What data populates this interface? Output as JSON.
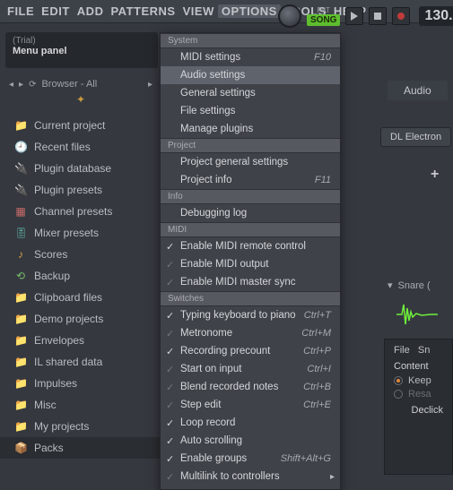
{
  "menubar": {
    "items": [
      "FILE",
      "EDIT",
      "ADD",
      "PATTERNS",
      "VIEW",
      "OPTIONS",
      "TOOLS",
      "HELP"
    ],
    "active_index": 5
  },
  "topbar": {
    "pat_label": "PAT",
    "song_label": "SONG",
    "tempo": "130."
  },
  "hint": {
    "trial": "(Trial)",
    "title": "Menu panel"
  },
  "browser": {
    "label": "Browser - All",
    "star": "✦"
  },
  "sidebar": {
    "items": [
      {
        "icon": "📁",
        "cls": "c-folder",
        "label": "Current project"
      },
      {
        "icon": "🕘",
        "cls": "c-blue",
        "label": "Recent files"
      },
      {
        "icon": "🔌",
        "cls": "c-blue",
        "label": "Plugin database"
      },
      {
        "icon": "🔌",
        "cls": "c-red",
        "label": "Plugin presets"
      },
      {
        "icon": "▦",
        "cls": "c-red",
        "label": "Channel presets"
      },
      {
        "icon": "🎚",
        "cls": "c-teal",
        "label": "Mixer presets"
      },
      {
        "icon": "♪",
        "cls": "c-folder",
        "label": "Scores"
      },
      {
        "icon": "⟲",
        "cls": "c-green",
        "label": "Backup"
      },
      {
        "icon": "📁",
        "cls": "c-folder",
        "label": "Clipboard files"
      },
      {
        "icon": "📁",
        "cls": "c-folder",
        "label": "Demo projects"
      },
      {
        "icon": "📁",
        "cls": "c-folder",
        "label": "Envelopes"
      },
      {
        "icon": "📁",
        "cls": "c-folder",
        "label": "IL shared data"
      },
      {
        "icon": "📁",
        "cls": "c-folder",
        "label": "Impulses"
      },
      {
        "icon": "📁",
        "cls": "c-folder",
        "label": "Misc"
      },
      {
        "icon": "📁",
        "cls": "c-folder",
        "label": "My projects"
      },
      {
        "icon": "📦",
        "cls": "c-orange",
        "label": "Packs",
        "sel": true
      }
    ]
  },
  "dropdown": {
    "sections": [
      {
        "title": "System",
        "items": [
          {
            "label": "MIDI settings",
            "short": "F10"
          },
          {
            "label": "Audio settings",
            "hover": true
          },
          {
            "label": "General settings"
          },
          {
            "label": "File settings"
          },
          {
            "label": "Manage plugins"
          }
        ]
      },
      {
        "title": "Project",
        "items": [
          {
            "label": "Project general settings"
          },
          {
            "label": "Project info",
            "short": "F11"
          }
        ]
      },
      {
        "title": "Info",
        "items": [
          {
            "label": "Debugging log"
          }
        ]
      },
      {
        "title": "MIDI",
        "items": [
          {
            "label": "Enable MIDI remote control",
            "check": "on"
          },
          {
            "label": "Enable MIDI output",
            "check": "off"
          },
          {
            "label": "Enable MIDI master sync",
            "check": "off"
          }
        ]
      },
      {
        "title": "Switches",
        "items": [
          {
            "label": "Typing keyboard to piano",
            "check": "on",
            "short": "Ctrl+T"
          },
          {
            "label": "Metronome",
            "check": "off",
            "short": "Ctrl+M"
          },
          {
            "label": "Recording precount",
            "check": "on",
            "short": "Ctrl+P"
          },
          {
            "label": "Start on input",
            "check": "off",
            "short": "Ctrl+I"
          },
          {
            "label": "Blend recorded notes",
            "check": "off",
            "short": "Ctrl+B"
          },
          {
            "label": "Step edit",
            "check": "off",
            "short": "Ctrl+E"
          },
          {
            "label": "Loop record",
            "check": "on"
          },
          {
            "label": "Auto scrolling",
            "check": "on"
          },
          {
            "label": "Enable groups",
            "check": "on",
            "short": "Shift+Alt+G"
          },
          {
            "label": "Multilink to controllers",
            "check": "off",
            "submenu": true
          }
        ]
      }
    ]
  },
  "right": {
    "tab": "Audio",
    "dl_button": "DL Electron",
    "snare": "Snare (",
    "file_tab": "File",
    "sn_tab": "Sn",
    "content_hdr": "Content",
    "keep": "Keep",
    "resa": "Resa",
    "declick": "Declick"
  }
}
